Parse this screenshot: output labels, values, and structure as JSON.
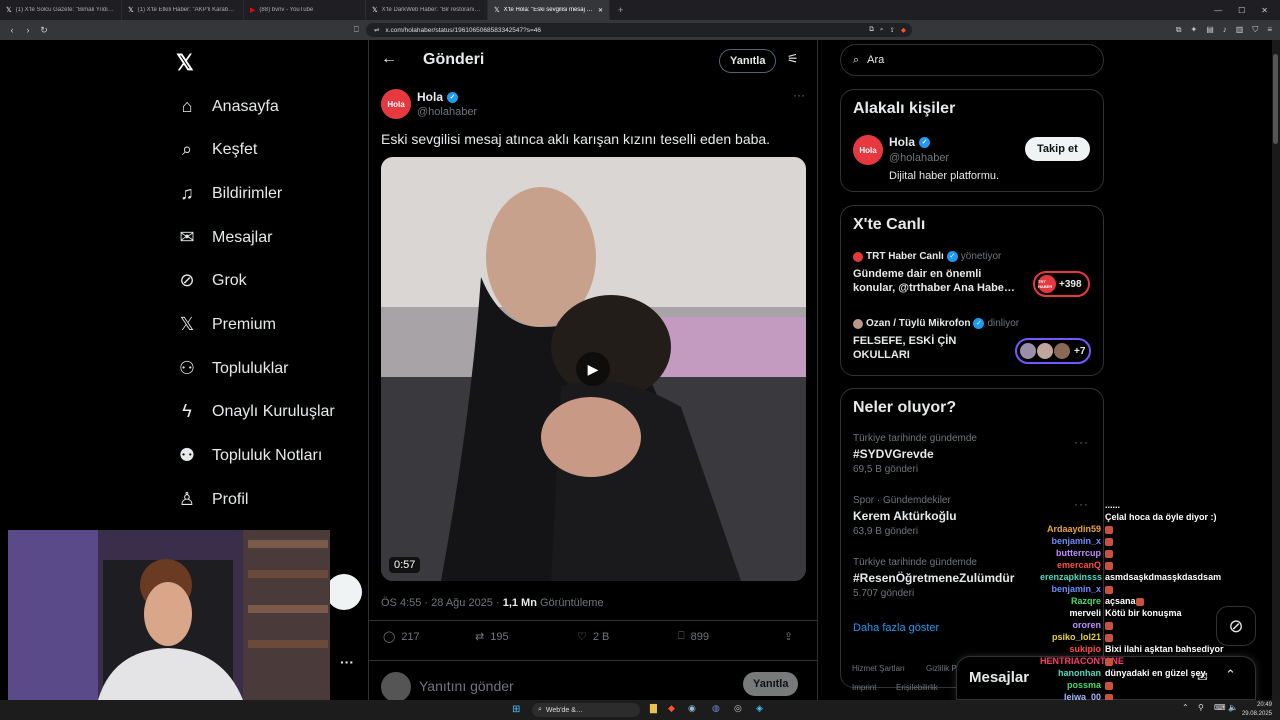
{
  "browser": {
    "tabs": [
      {
        "favicon": "x-logo-icon",
        "title": "(1) X'te Solcu Gazete: \"Bimali Yıldırım…"
      },
      {
        "favicon": "x-logo-icon",
        "title": "(1) X'te Etkili Haber: \"AKP'li Karabük…"
      },
      {
        "favicon": "youtube-icon",
        "title": "(88) bvnv - YouTube"
      },
      {
        "favicon": "x-logo-icon",
        "title": "X'te DarkWeb Haber: \"Bir restoranın…"
      },
      {
        "favicon": "x-logo-icon",
        "title": "X'te Hola: \"Eski sevgilisi mesaj at…"
      }
    ],
    "active_tab": 4,
    "url": "x.com/holahaber/status/1961065068583342547?s=46"
  },
  "nav": {
    "items": [
      {
        "label": "Anasayfa",
        "icon": "home-icon",
        "glyph": "⌂"
      },
      {
        "label": "Keşfet",
        "icon": "search-icon",
        "glyph": "⌕"
      },
      {
        "label": "Bildirimler",
        "icon": "bell-icon",
        "glyph": "🔔"
      },
      {
        "label": "Mesajlar",
        "icon": "mail-icon",
        "glyph": "✉"
      },
      {
        "label": "Grok",
        "icon": "grok-icon",
        "glyph": "⊘"
      },
      {
        "label": "Premium",
        "icon": "x-logo-icon",
        "glyph": "𝕏"
      },
      {
        "label": "Topluluklar",
        "icon": "people-icon",
        "glyph": "👥"
      },
      {
        "label": "Onaylı Kuruluşlar",
        "icon": "lightning-icon",
        "glyph": "ϟ"
      },
      {
        "label": "Topluluk Notları",
        "icon": "community-notes-icon",
        "glyph": "👥"
      },
      {
        "label": "Profil",
        "icon": "person-icon",
        "glyph": "👤"
      }
    ]
  },
  "post": {
    "header_title": "Gönderi",
    "reply_button": "Yanıtla",
    "author_name": "Hola",
    "author_handle": "@holahaber",
    "avatar_text": "Hola",
    "text": "Eski sevgilisi mesaj atınca aklı karışan kızını teselli eden baba.",
    "video_duration": "0:57",
    "timestamp": "ÖS 4:55 · 28 Ağu 2025 · ",
    "views": "1,1 Mn",
    "views_label": " Görüntüleme",
    "stats": {
      "replies": "217",
      "reposts": "195",
      "likes": "2 B",
      "bookmarks": "899"
    },
    "reply_placeholder": "Yanıtını gönder",
    "reply_submit": "Yanıtla"
  },
  "right": {
    "search_placeholder": "Ara",
    "relevant": {
      "title": "Alakalı kişiler",
      "name": "Hola",
      "handle": "@holahaber",
      "bio": "Dijital haber platformu.",
      "follow": "Takip et"
    },
    "live": {
      "title": "X'te Canlı",
      "items": [
        {
          "host": "TRT Haber Canlı",
          "role": "yönetiyor",
          "text1": "Gündeme dair en önemli",
          "text2": "konular, @trthaber Ana Habe…",
          "count": "+398",
          "thumb": "TRT HABER"
        },
        {
          "host": "Ozan / Tüylü Mikrofon",
          "role": "dinliyor",
          "text1": "FELSEFE, ESKİ ÇİN",
          "text2": "OKULLARI",
          "count": "+7",
          "thumb": ""
        }
      ]
    },
    "trends": {
      "title": "Neler oluyor?",
      "items": [
        {
          "cat": "Türkiye tarihinde gündemde",
          "tag": "#SYDVGrevde",
          "count": "69,5 B gönderi"
        },
        {
          "cat": "Spor · Gündemdekiler",
          "tag": "Kerem Aktürkoğlu",
          "count": "63,9 B gönderi"
        },
        {
          "cat": "Türkiye tarihinde gündemde",
          "tag": "#ResenÖğretmeneZulümdür",
          "count": "5.707 gönderi"
        }
      ],
      "more": "Daha fazla göster"
    },
    "footer": [
      "Hizmet Şartları",
      "Gizlilik P…",
      "Imprint",
      "Erişilebilirlik"
    ],
    "messages": "Mesajlar"
  },
  "chat": [
    {
      "user": "",
      "color": "#ffffff",
      "msg": "......"
    },
    {
      "user": "",
      "color": "#ffffff",
      "msg": "Çelal hoca da öyle diyor :)"
    },
    {
      "user": "Ardaaydin59",
      "color": "#e8a33c",
      "msg": ""
    },
    {
      "user": "benjamin_x",
      "color": "#6f8cff",
      "msg": ""
    },
    {
      "user": "butterrcup",
      "color": "#c08cff",
      "msg": ""
    },
    {
      "user": "emercanQ",
      "color": "#ff4a4a",
      "msg": ""
    },
    {
      "user": "erenzapkinsss",
      "color": "#4ad9c0",
      "msg": "asmdsaşkdmasşkdasdsam"
    },
    {
      "user": "benjamin_x",
      "color": "#6f8cff",
      "msg": ""
    },
    {
      "user": "Razqre",
      "color": "#4ad96b",
      "msg": "açsana"
    },
    {
      "user": "merveli",
      "color": "#ffffff",
      "msg": "Kötü bir konuşma"
    },
    {
      "user": "ororen",
      "color": "#c08cff",
      "msg": ""
    },
    {
      "user": "psiko_lol21",
      "color": "#e8d23c",
      "msg": ""
    },
    {
      "user": "sukipio",
      "color": "#ff4a4a",
      "msg": "Bixi ilahi aşktan bahsediyor"
    },
    {
      "user": "HENTRIACONTANE",
      "color": "#ff3a6b",
      "msg": ""
    },
    {
      "user": "hanonhan",
      "color": "#4ad9c0",
      "msg": "dünyadaki en güzel şey"
    },
    {
      "user": "possma",
      "color": "#4ad96b",
      "msg": ""
    },
    {
      "user": "leiwa_00",
      "color": "#a8b4ff",
      "msg": ""
    }
  ],
  "taskbar": {
    "search": "Web'de &…",
    "time": "20:49",
    "date": "29.08.2025"
  }
}
